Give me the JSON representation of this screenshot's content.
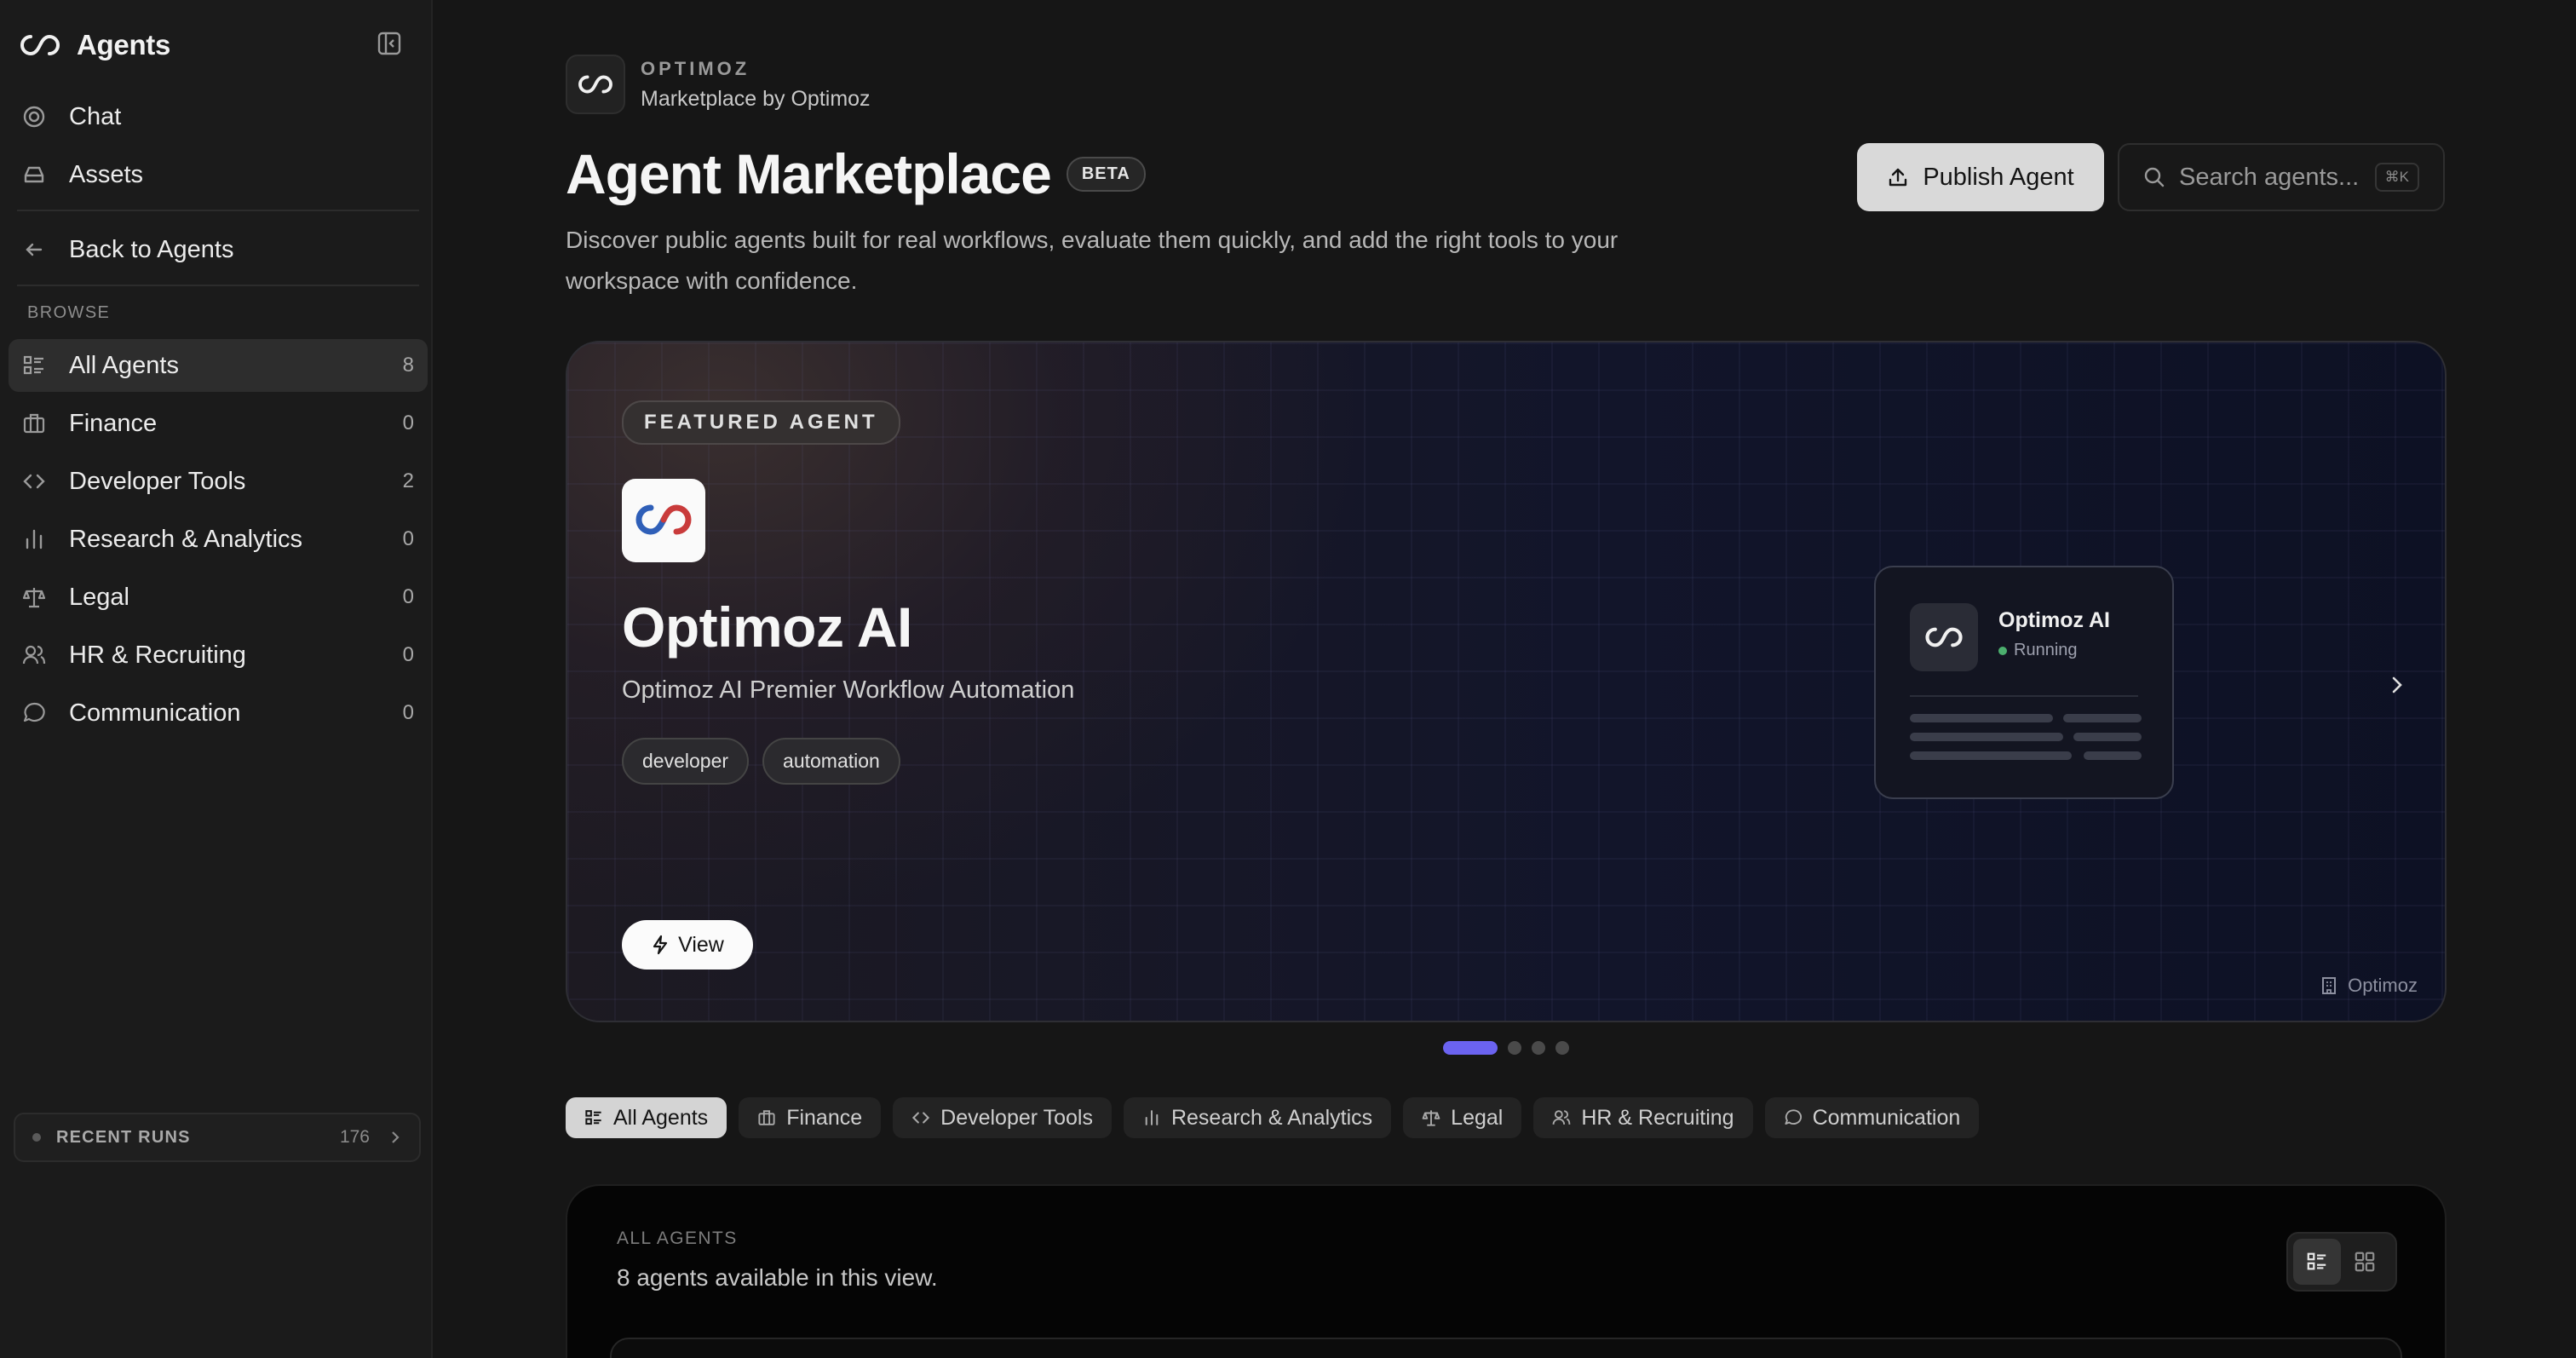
{
  "sidebar": {
    "title": "Agents",
    "top_items": [
      {
        "label": "Chat",
        "icon": "chat-icon"
      },
      {
        "label": "Assets",
        "icon": "assets-icon"
      }
    ],
    "back_label": "Back to Agents",
    "section_label": "BROWSE",
    "categories": [
      {
        "label": "All Agents",
        "count": "8",
        "icon": "list-icon",
        "active": true
      },
      {
        "label": "Finance",
        "count": "0",
        "icon": "briefcase-icon"
      },
      {
        "label": "Developer Tools",
        "count": "2",
        "icon": "code-icon"
      },
      {
        "label": "Research & Analytics",
        "count": "0",
        "icon": "bar-chart-icon"
      },
      {
        "label": "Legal",
        "count": "0",
        "icon": "scale-icon"
      },
      {
        "label": "HR & Recruiting",
        "count": "0",
        "icon": "users-icon"
      },
      {
        "label": "Communication",
        "count": "0",
        "icon": "message-icon"
      }
    ],
    "recent_runs": {
      "label": "RECENT RUNS",
      "count": "176"
    }
  },
  "header": {
    "brand_kicker": "OPTIMOZ",
    "brand_sub": "Marketplace by Optimoz",
    "title": "Agent Marketplace",
    "badge": "BETA",
    "description": "Discover public agents built for real workflows, evaluate them quickly, and add the right tools to your workspace with confidence.",
    "publish_label": "Publish Agent",
    "search_placeholder": "Search agents...",
    "search_shortcut": "⌘K"
  },
  "featured": {
    "badge": "FEATURED AGENT",
    "name": "Optimoz AI",
    "subtitle": "Optimoz AI Premier Workflow Automation",
    "tags": [
      "developer",
      "automation"
    ],
    "view_label": "View",
    "preview_name": "Optimoz AI",
    "preview_status": "Running",
    "owner": "Optimoz",
    "carousel_total": 4,
    "carousel_active": 1
  },
  "filters": [
    {
      "label": "All Agents",
      "icon": "list-icon",
      "active": true
    },
    {
      "label": "Finance",
      "icon": "briefcase-icon"
    },
    {
      "label": "Developer Tools",
      "icon": "code-icon"
    },
    {
      "label": "Research & Analytics",
      "icon": "bar-chart-icon"
    },
    {
      "label": "Legal",
      "icon": "scale-icon"
    },
    {
      "label": "HR & Recruiting",
      "icon": "users-icon"
    },
    {
      "label": "Communication",
      "icon": "message-icon"
    }
  ],
  "listing": {
    "kicker": "ALL AGENTS",
    "subtitle": "8 agents available in this view."
  },
  "colors": {
    "accent": "#6b63f0",
    "running": "#4caf6e"
  }
}
